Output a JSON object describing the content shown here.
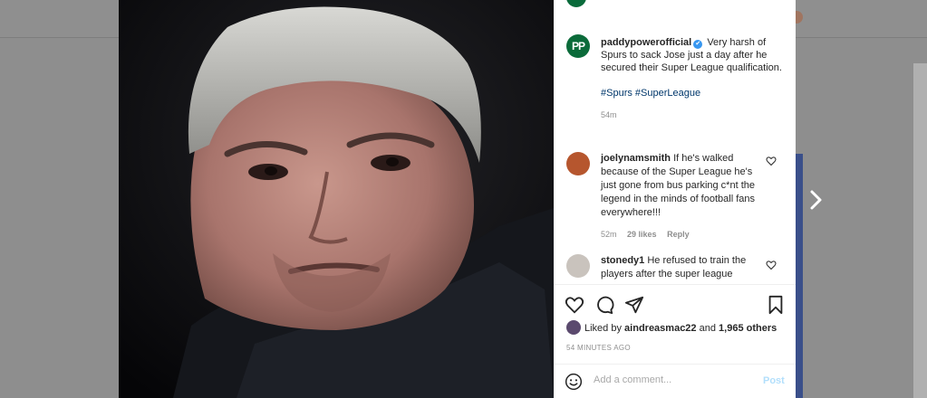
{
  "post": {
    "username": "paddypowerofficial",
    "logo_text": "PP",
    "caption": "Very harsh of Spurs to sack Jose just a day after he secured their Super League qualification.",
    "hashtags": "#Spurs #SuperLeague",
    "caption_time": "54m",
    "verified_icon": "✔"
  },
  "comments": [
    {
      "username": "joelynamsmith",
      "text": "If he's walked because of the Super League he's just gone from bus parking c*nt the legend in the minds of football fans everywhere!!!",
      "time": "52m",
      "likes": "29 likes",
      "reply": "Reply"
    },
    {
      "username": "stonedy1",
      "text": "He refused to train the players after the super league"
    }
  ],
  "likes": {
    "prefix": "Liked by",
    "user": "aindreasmac22",
    "joiner": "and",
    "others": "1,965 others"
  },
  "post_time": "54 MINUTES AGO",
  "comment_box": {
    "placeholder": "Add a comment...",
    "post_label": "Post"
  },
  "colors": {
    "brand_green": "#0b6b3a",
    "link_blue": "#00376b",
    "post_disabled": "#b2dffc"
  },
  "icons": [
    "heart-icon",
    "comment-icon",
    "share-icon",
    "bookmark-icon",
    "emoji-icon",
    "chevron-right-icon",
    "verified-icon"
  ]
}
